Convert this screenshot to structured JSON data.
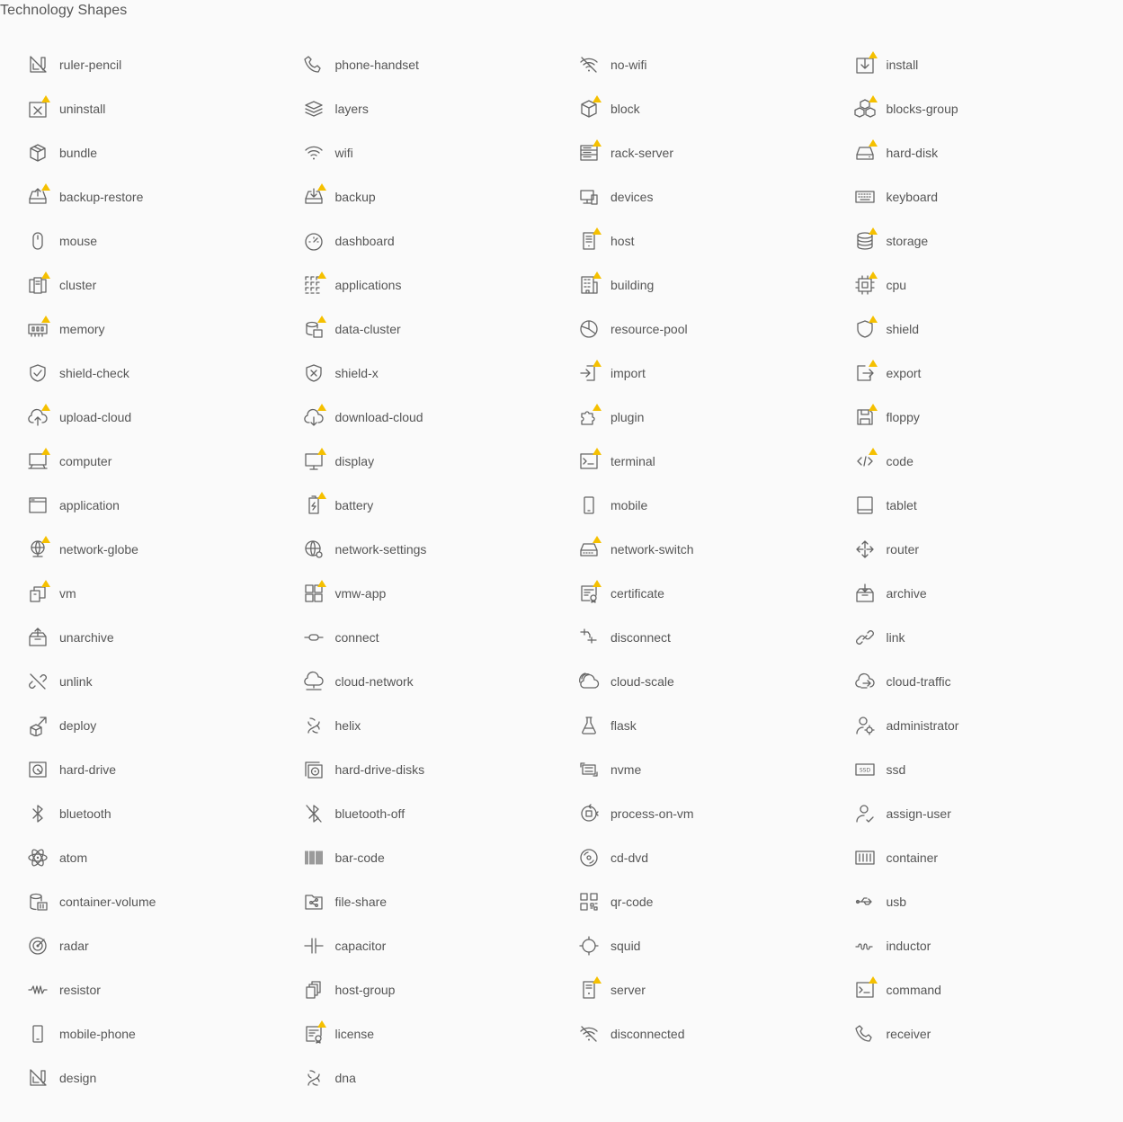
{
  "title": "Technology Shapes",
  "colors": {
    "background": "#fafafa",
    "text": "#565656",
    "icon_stroke": "#666666",
    "badge": "#f5c000"
  },
  "icons": [
    {
      "label": "ruler-pencil",
      "icon": "ruler-pencil-icon",
      "badge": false
    },
    {
      "label": "phone-handset",
      "icon": "phone-handset-icon",
      "badge": false
    },
    {
      "label": "no-wifi",
      "icon": "no-wifi-icon",
      "badge": false
    },
    {
      "label": "install",
      "icon": "install-icon",
      "badge": true
    },
    {
      "label": "uninstall",
      "icon": "uninstall-icon",
      "badge": true
    },
    {
      "label": "layers",
      "icon": "layers-icon",
      "badge": false
    },
    {
      "label": "block",
      "icon": "block-icon",
      "badge": true
    },
    {
      "label": "blocks-group",
      "icon": "blocks-group-icon",
      "badge": true
    },
    {
      "label": "bundle",
      "icon": "bundle-icon",
      "badge": false
    },
    {
      "label": "wifi",
      "icon": "wifi-icon",
      "badge": false
    },
    {
      "label": "rack-server",
      "icon": "rack-server-icon",
      "badge": true
    },
    {
      "label": "hard-disk",
      "icon": "hard-disk-icon",
      "badge": true
    },
    {
      "label": "backup-restore",
      "icon": "backup-restore-icon",
      "badge": true
    },
    {
      "label": "backup",
      "icon": "backup-icon",
      "badge": true
    },
    {
      "label": "devices",
      "icon": "devices-icon",
      "badge": false
    },
    {
      "label": "keyboard",
      "icon": "keyboard-icon",
      "badge": false
    },
    {
      "label": "mouse",
      "icon": "mouse-icon",
      "badge": false
    },
    {
      "label": "dashboard",
      "icon": "dashboard-icon",
      "badge": false
    },
    {
      "label": "host",
      "icon": "host-icon",
      "badge": true
    },
    {
      "label": "storage",
      "icon": "storage-icon",
      "badge": true
    },
    {
      "label": "cluster",
      "icon": "cluster-icon",
      "badge": true
    },
    {
      "label": "applications",
      "icon": "applications-icon",
      "badge": true
    },
    {
      "label": "building",
      "icon": "building-icon",
      "badge": true
    },
    {
      "label": "cpu",
      "icon": "cpu-icon",
      "badge": true
    },
    {
      "label": "memory",
      "icon": "memory-icon",
      "badge": true
    },
    {
      "label": "data-cluster",
      "icon": "data-cluster-icon",
      "badge": true
    },
    {
      "label": "resource-pool",
      "icon": "resource-pool-icon",
      "badge": false
    },
    {
      "label": "shield",
      "icon": "shield-icon",
      "badge": true
    },
    {
      "label": "shield-check",
      "icon": "shield-check-icon",
      "badge": false
    },
    {
      "label": "shield-x",
      "icon": "shield-x-icon",
      "badge": false
    },
    {
      "label": "import",
      "icon": "import-icon",
      "badge": true
    },
    {
      "label": "export",
      "icon": "export-icon",
      "badge": true
    },
    {
      "label": "upload-cloud",
      "icon": "upload-cloud-icon",
      "badge": true
    },
    {
      "label": "download-cloud",
      "icon": "download-cloud-icon",
      "badge": true
    },
    {
      "label": "plugin",
      "icon": "plugin-icon",
      "badge": true
    },
    {
      "label": "floppy",
      "icon": "floppy-icon",
      "badge": true
    },
    {
      "label": "computer",
      "icon": "computer-icon",
      "badge": true
    },
    {
      "label": "display",
      "icon": "display-icon",
      "badge": true
    },
    {
      "label": "terminal",
      "icon": "terminal-icon",
      "badge": true
    },
    {
      "label": "code",
      "icon": "code-icon",
      "badge": true
    },
    {
      "label": "application",
      "icon": "application-icon",
      "badge": false
    },
    {
      "label": "battery",
      "icon": "battery-icon",
      "badge": true
    },
    {
      "label": "mobile",
      "icon": "mobile-icon",
      "badge": false
    },
    {
      "label": "tablet",
      "icon": "tablet-icon",
      "badge": false
    },
    {
      "label": "network-globe",
      "icon": "network-globe-icon",
      "badge": true
    },
    {
      "label": "network-settings",
      "icon": "network-settings-icon",
      "badge": false
    },
    {
      "label": "network-switch",
      "icon": "network-switch-icon",
      "badge": true
    },
    {
      "label": "router",
      "icon": "router-icon",
      "badge": false
    },
    {
      "label": "vm",
      "icon": "vm-icon",
      "badge": true
    },
    {
      "label": "vmw-app",
      "icon": "vmw-app-icon",
      "badge": true
    },
    {
      "label": "certificate",
      "icon": "certificate-icon",
      "badge": true
    },
    {
      "label": "archive",
      "icon": "archive-icon",
      "badge": false
    },
    {
      "label": "unarchive",
      "icon": "unarchive-icon",
      "badge": false
    },
    {
      "label": "connect",
      "icon": "connect-icon",
      "badge": false
    },
    {
      "label": "disconnect",
      "icon": "disconnect-icon",
      "badge": false
    },
    {
      "label": "link",
      "icon": "link-icon",
      "badge": false
    },
    {
      "label": "unlink",
      "icon": "unlink-icon",
      "badge": false
    },
    {
      "label": "cloud-network",
      "icon": "cloud-network-icon",
      "badge": false
    },
    {
      "label": "cloud-scale",
      "icon": "cloud-scale-icon",
      "badge": false
    },
    {
      "label": "cloud-traffic",
      "icon": "cloud-traffic-icon",
      "badge": false
    },
    {
      "label": "deploy",
      "icon": "deploy-icon",
      "badge": false
    },
    {
      "label": "helix",
      "icon": "helix-icon",
      "badge": false
    },
    {
      "label": "flask",
      "icon": "flask-icon",
      "badge": false
    },
    {
      "label": "administrator",
      "icon": "administrator-icon",
      "badge": false
    },
    {
      "label": "hard-drive",
      "icon": "hard-drive-icon",
      "badge": false
    },
    {
      "label": "hard-drive-disks",
      "icon": "hard-drive-disks-icon",
      "badge": false
    },
    {
      "label": "nvme",
      "icon": "nvme-icon",
      "badge": false
    },
    {
      "label": "ssd",
      "icon": "ssd-icon",
      "badge": false
    },
    {
      "label": "bluetooth",
      "icon": "bluetooth-icon",
      "badge": false
    },
    {
      "label": "bluetooth-off",
      "icon": "bluetooth-off-icon",
      "badge": false
    },
    {
      "label": "process-on-vm",
      "icon": "process-on-vm-icon",
      "badge": false
    },
    {
      "label": "assign-user",
      "icon": "assign-user-icon",
      "badge": false
    },
    {
      "label": "atom",
      "icon": "atom-icon",
      "badge": false
    },
    {
      "label": "bar-code",
      "icon": "bar-code-icon",
      "badge": false
    },
    {
      "label": "cd-dvd",
      "icon": "cd-dvd-icon",
      "badge": false
    },
    {
      "label": "container",
      "icon": "container-icon",
      "badge": false
    },
    {
      "label": "container-volume",
      "icon": "container-volume-icon",
      "badge": false
    },
    {
      "label": "file-share",
      "icon": "file-share-icon",
      "badge": false
    },
    {
      "label": "qr-code",
      "icon": "qr-code-icon",
      "badge": false
    },
    {
      "label": "usb",
      "icon": "usb-icon",
      "badge": false
    },
    {
      "label": "radar",
      "icon": "radar-icon",
      "badge": false
    },
    {
      "label": "capacitor",
      "icon": "capacitor-icon",
      "badge": false
    },
    {
      "label": "squid",
      "icon": "squid-icon",
      "badge": false
    },
    {
      "label": "inductor",
      "icon": "inductor-icon",
      "badge": false
    },
    {
      "label": "resistor",
      "icon": "resistor-icon",
      "badge": false
    },
    {
      "label": "host-group",
      "icon": "host-group-icon",
      "badge": false
    },
    {
      "label": "server",
      "icon": "server-icon",
      "badge": true
    },
    {
      "label": "command",
      "icon": "command-icon",
      "badge": true
    },
    {
      "label": "mobile-phone",
      "icon": "mobile-phone-icon",
      "badge": false
    },
    {
      "label": "license",
      "icon": "license-icon",
      "badge": true
    },
    {
      "label": "disconnected",
      "icon": "disconnected-icon",
      "badge": false
    },
    {
      "label": "receiver",
      "icon": "receiver-icon",
      "badge": false
    },
    {
      "label": "design",
      "icon": "design-icon",
      "badge": false
    },
    {
      "label": "dna",
      "icon": "dna-icon",
      "badge": false
    }
  ]
}
